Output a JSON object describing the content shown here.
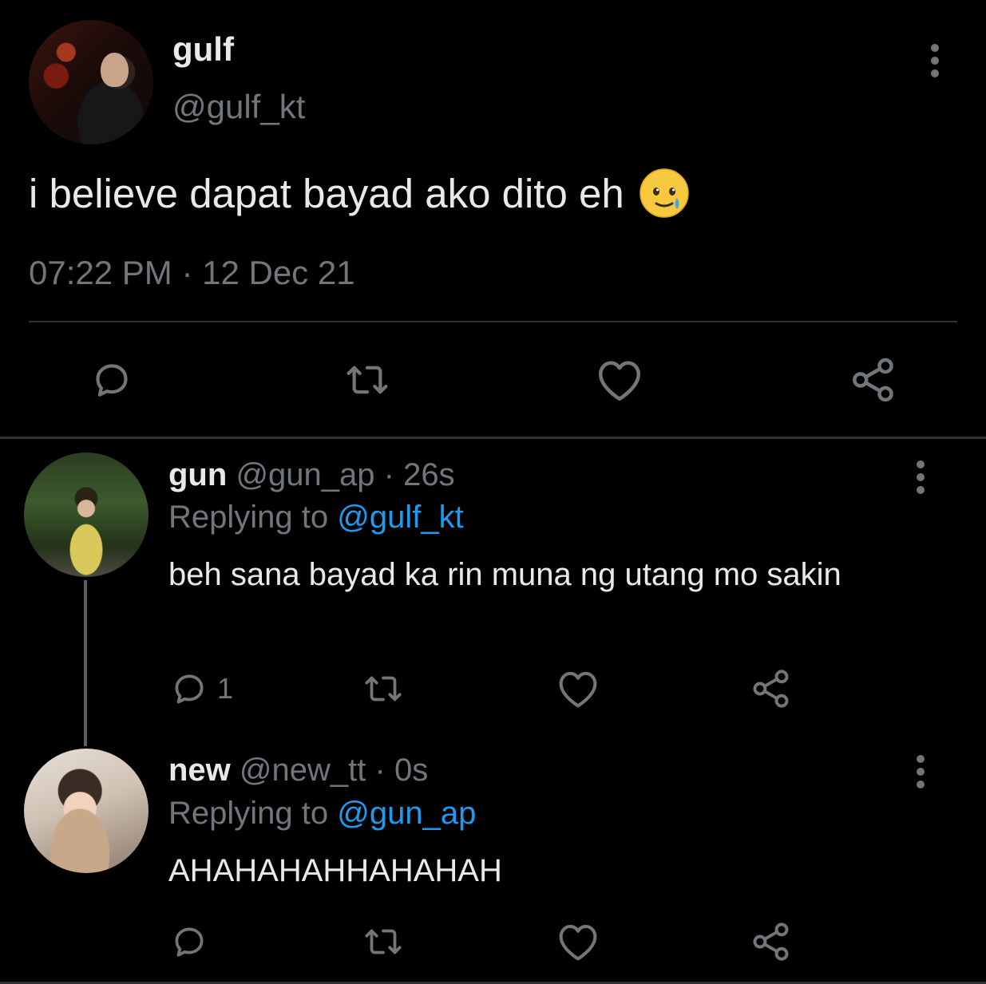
{
  "main_tweet": {
    "display_name": "gulf",
    "handle": "@gulf_kt",
    "text": "i believe dapat bayad ako dito eh",
    "emoji_icon": "face-holding-back-tears-emoji",
    "timestamp": "07:22 PM · 12 Dec 21",
    "actions": [
      "reply-icon",
      "retweet-icon",
      "like-icon",
      "share-icon"
    ]
  },
  "replies": [
    {
      "display_name": "gun",
      "handle": "@gun_ap",
      "separator": "·",
      "time": "26s",
      "replying_prefix": "Replying to",
      "replying_to": "@gulf_kt",
      "text": "beh sana bayad ka rin muna ng utang mo sakin",
      "reply_count": "1"
    },
    {
      "display_name": "new",
      "handle": "@new_tt",
      "separator": "·",
      "time": "0s",
      "replying_prefix": "Replying to",
      "replying_to": "@gun_ap",
      "text": "AHAHAHAHHAHAHAH",
      "reply_count": ""
    }
  ],
  "colors": {
    "background": "#000000",
    "primary_text": "#e7e9ea",
    "secondary_text": "#71767b",
    "accent_link": "#1d9bf0",
    "divider": "#2f3336"
  }
}
